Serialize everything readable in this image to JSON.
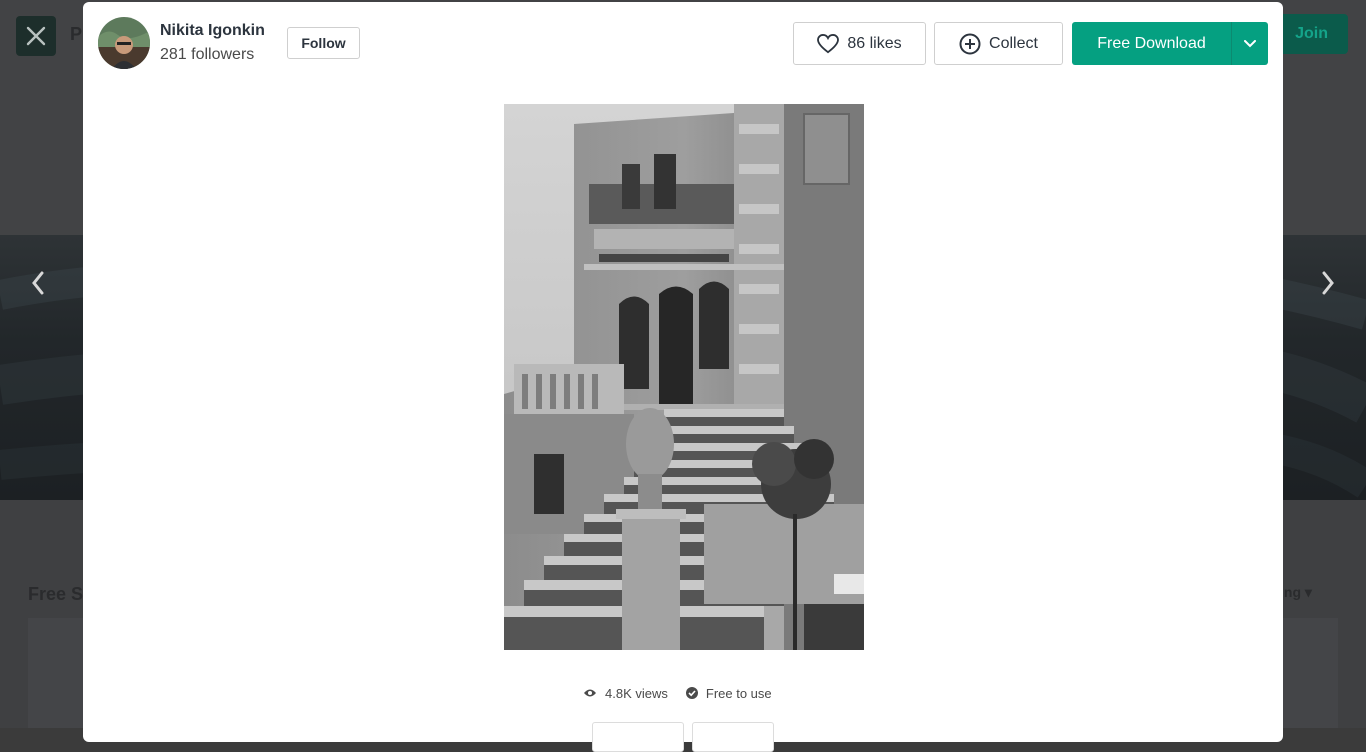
{
  "background": {
    "section_title": "Free S",
    "sort_label": "ing",
    "join_label": "Join",
    "partial_nav_label": "P"
  },
  "author": {
    "name": "Nikita Igonkin",
    "followers": "281 followers",
    "follow_label": "Follow"
  },
  "actions": {
    "likes_label": "86 likes",
    "collect_label": "Collect",
    "download_label": "Free Download"
  },
  "stats": {
    "views": "4.8K views",
    "license": "Free to use"
  },
  "icons": {
    "close": "close-icon",
    "prev": "chevron-left-icon",
    "next": "chevron-right-icon",
    "like": "heart-icon",
    "collect": "plus-circle-icon",
    "download_more": "chevron-down-icon",
    "views": "eye-icon",
    "license": "check-circle-icon"
  },
  "colors": {
    "accent": "#05a081",
    "text": "#2c343e"
  }
}
